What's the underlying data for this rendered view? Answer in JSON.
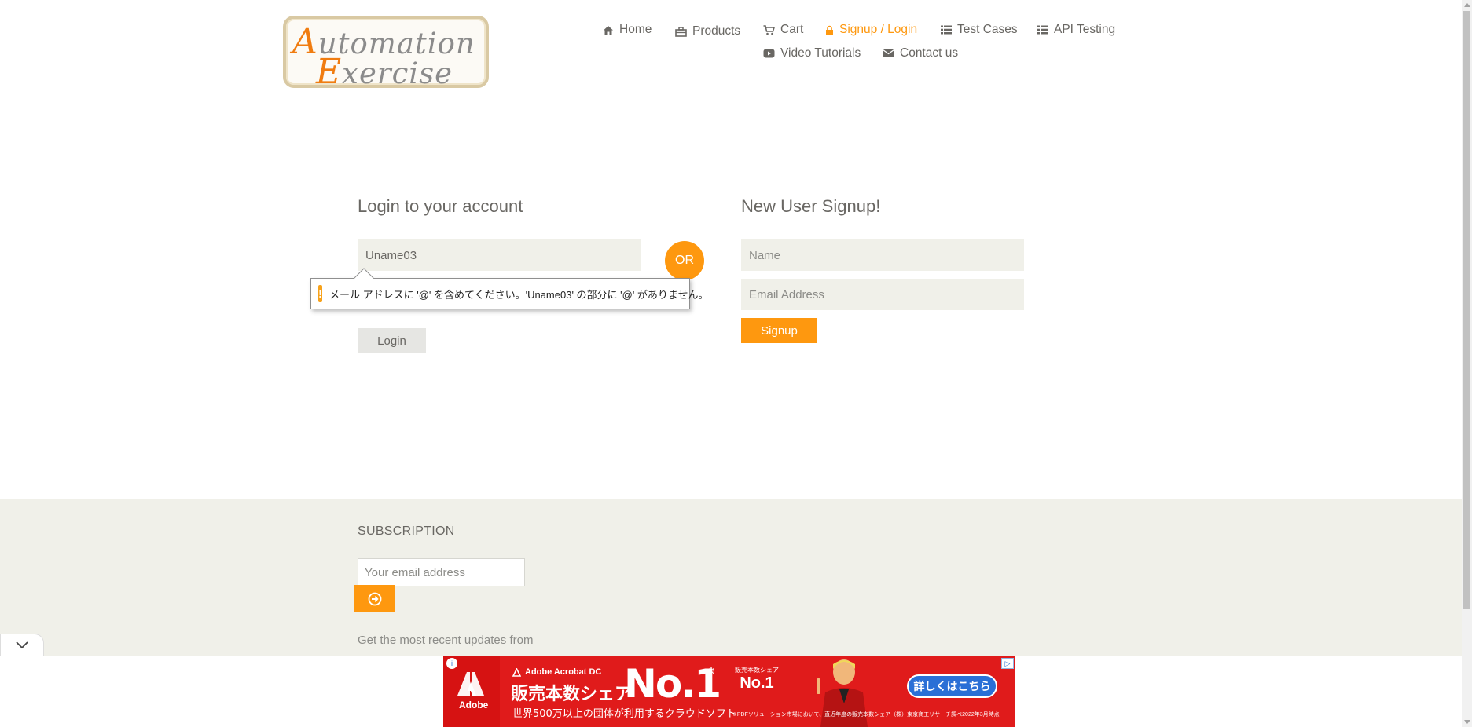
{
  "logo": {
    "line1_cap": "A",
    "line1_rest": "utomation",
    "line2_cap": "E",
    "line2_rest": "xercise"
  },
  "nav": {
    "home": "Home",
    "products": "Products",
    "cart": "Cart",
    "signup_login": "Signup / Login",
    "test_cases": "Test Cases",
    "api_testing": "API Testing",
    "video_tutorials": "Video Tutorials",
    "contact_us": "Contact us"
  },
  "login": {
    "title": "Login to your account",
    "email_value": "Uname03",
    "button": "Login"
  },
  "or_label": "OR",
  "validation": {
    "message": "メール アドレスに '@' を含めてください。'Uname03' の部分に '@' がありません。"
  },
  "signup": {
    "title": "New User Signup!",
    "name_placeholder": "Name",
    "email_placeholder": "Email Address",
    "button": "Signup"
  },
  "footer": {
    "subscription_title": "SUBSCRIPTION",
    "email_placeholder": "Your email address",
    "description_line1": "Get the most recent updates from"
  },
  "ad": {
    "product": "Adobe Acrobat DC",
    "brand": "Adobe",
    "headline": "販売本数シェア",
    "no1": "No.1",
    "star": "※",
    "subline": "世界500万以上の団体が利用するクラウドソフト",
    "badge_top": "販売本数シェア",
    "badge_big": "No.1",
    "cta": "詳しくはこちら",
    "fineprint": "※PDFソリューション市場において、直近年度の販売本数シェア（株）東京商工リサーチ調べ2022年3月時点"
  },
  "colors": {
    "accent": "#FE980F",
    "field_bg": "#F0F0E9",
    "text": "#696763",
    "ad_red": "#E01B1B"
  }
}
